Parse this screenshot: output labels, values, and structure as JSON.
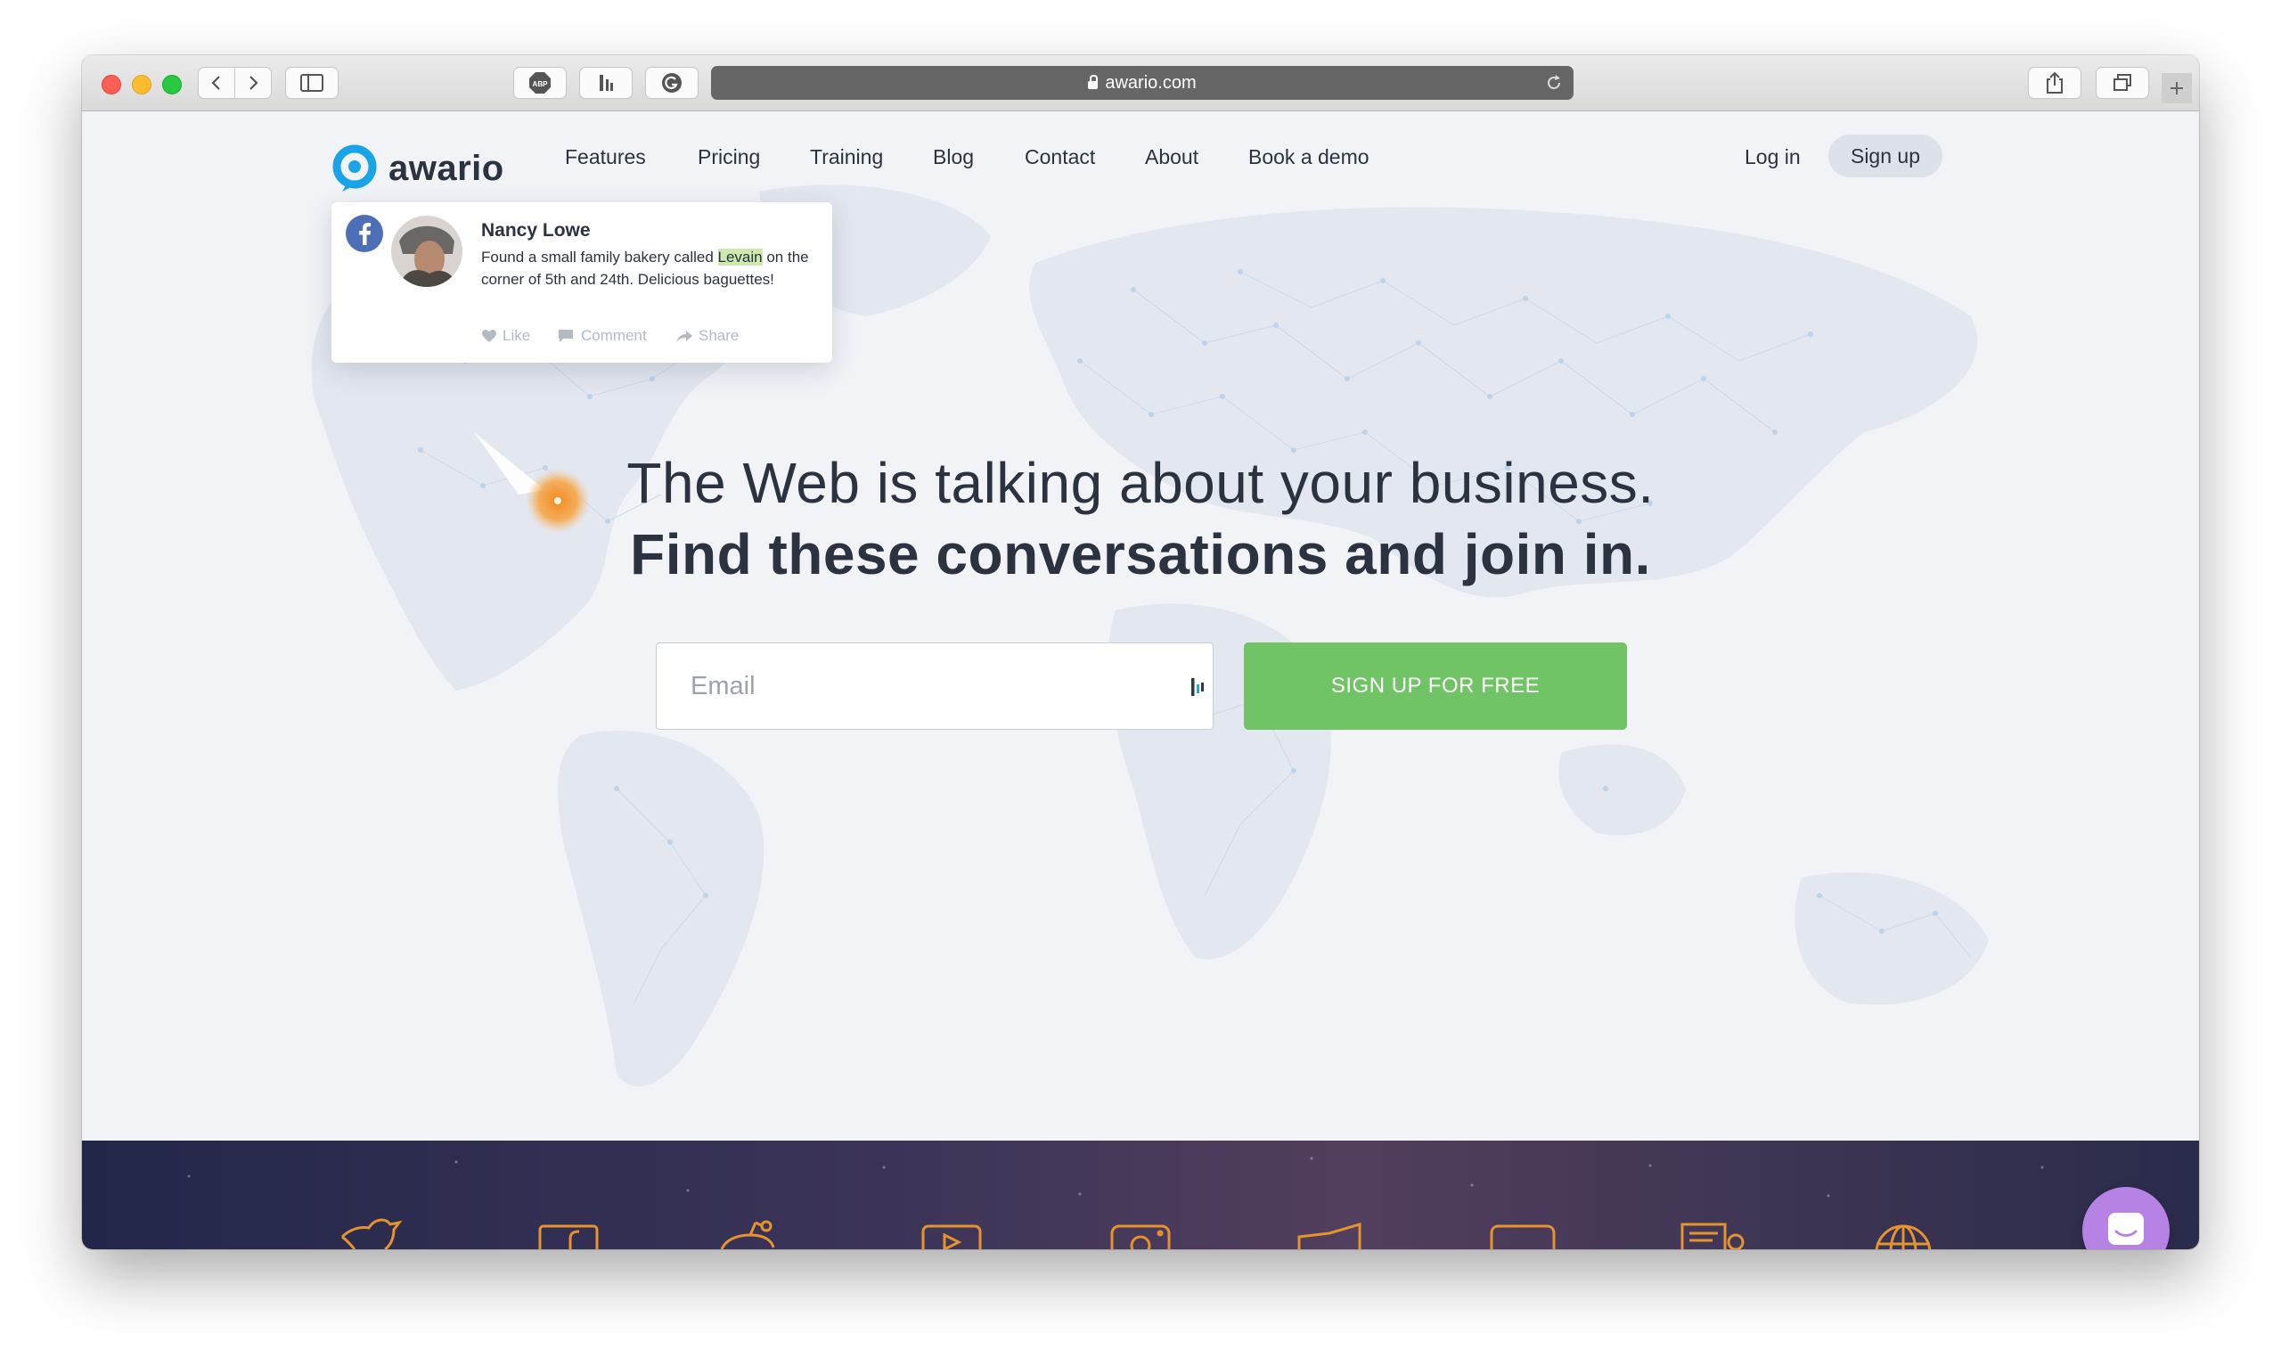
{
  "browser": {
    "url": "awario.com",
    "adblock_label": "ABP"
  },
  "nav": {
    "brand": "awario",
    "links": [
      "Features",
      "Pricing",
      "Training",
      "Blog",
      "Contact",
      "About",
      "Book a demo"
    ],
    "login": "Log in",
    "signup": "Sign up"
  },
  "mention_card": {
    "author": "Nancy Lowe",
    "text_before": "Found a small family bakery called ",
    "highlight": "Levain",
    "text_after": " on the corner of 5th and 24th. Delicious baguettes!",
    "actions": [
      "Like",
      "Comment",
      "Share"
    ],
    "source_icon": "facebook-icon"
  },
  "hero": {
    "headline": "The Web is talking about your business.",
    "subheadline": "Find these conversations and join in.",
    "email_placeholder": "Email",
    "cta": "SIGN UP FOR FREE"
  },
  "colors": {
    "brand_blue": "#1aa4e8",
    "cta_green": "#70c466",
    "text_dark": "#2b3240",
    "band_dark": "#2d2d4f",
    "source_icon_orange": "#e5932e",
    "chat_purple": "#b683e4"
  },
  "source_icons": [
    "twitter-icon",
    "facebook-icon",
    "reddit-icon",
    "youtube-icon",
    "instagram-icon",
    "news-icon",
    "forum-icon",
    "blog-icon",
    "web-icon"
  ]
}
